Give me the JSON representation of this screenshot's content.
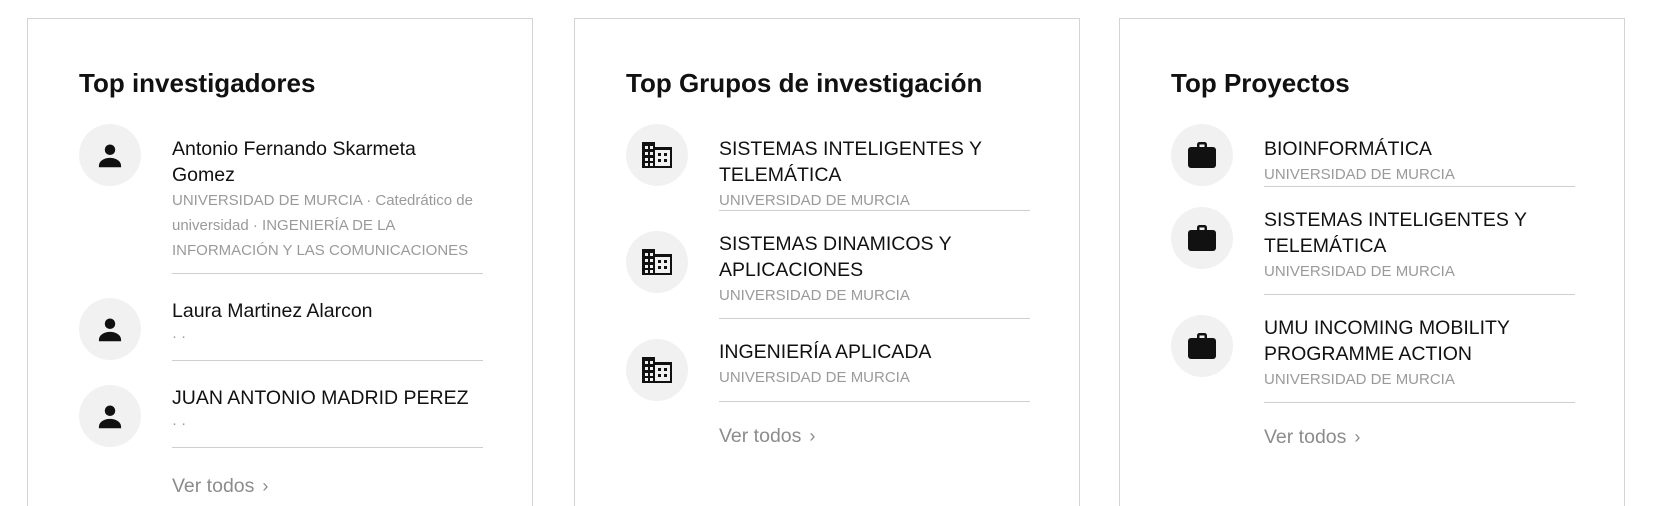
{
  "cards": [
    {
      "title": "Top investigadores",
      "icon": "person-icon",
      "items": [
        {
          "name": "Antonio Fernando Skarmeta Gomez",
          "meta": "UNIVERSIDAD DE MURCIA · Catedrático de universidad · INGENIERÍA DE LA INFORMACIÓN Y LAS COMUNICACIONES"
        },
        {
          "name": "Laura Martinez Alarcon",
          "meta": "· ·"
        },
        {
          "name": "JUAN ANTONIO MADRID PEREZ",
          "meta": "· ·"
        }
      ],
      "see_all": "Ver todos"
    },
    {
      "title": "Top Grupos de investigación",
      "icon": "building-icon",
      "items": [
        {
          "name": "SISTEMAS INTELIGENTES Y TELEMÁTICA",
          "meta": "UNIVERSIDAD DE MURCIA"
        },
        {
          "name": "SISTEMAS DINAMICOS Y APLICACIONES",
          "meta": "UNIVERSIDAD DE MURCIA"
        },
        {
          "name": "INGENIERÍA APLICADA",
          "meta": "UNIVERSIDAD DE MURCIA"
        }
      ],
      "see_all": "Ver todos"
    },
    {
      "title": "Top Proyectos",
      "icon": "briefcase-icon",
      "items": [
        {
          "name": "BIOINFORMÁTICA",
          "meta": "UNIVERSIDAD DE MURCIA"
        },
        {
          "name": "SISTEMAS INTELIGENTES Y TELEMÁTICA",
          "meta": "UNIVERSIDAD DE MURCIA"
        },
        {
          "name": "UMU INCOMING MOBILITY PROGRAMME ACTION",
          "meta": "UNIVERSIDAD DE MURCIA"
        }
      ],
      "see_all": "Ver todos"
    }
  ]
}
